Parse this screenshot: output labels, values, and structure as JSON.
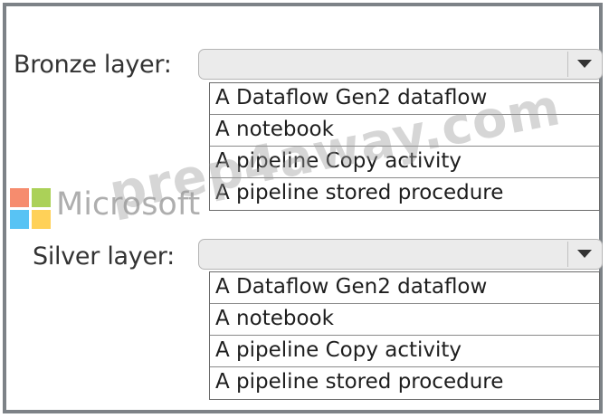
{
  "bronze": {
    "label": "Bronze layer:",
    "options": [
      "A Dataflow Gen2 dataflow",
      "A notebook",
      "A pipeline Copy activity",
      "A pipeline stored procedure"
    ]
  },
  "silver": {
    "label": "Silver layer:",
    "options": [
      "A Dataflow Gen2 dataflow",
      "A notebook",
      "A pipeline Copy activity",
      "A pipeline stored procedure"
    ]
  },
  "watermark": {
    "brand": "Microsoft",
    "site": "prep4away.com",
    "logo_colors": [
      "#f25022",
      "#7fba00",
      "#00a4ef",
      "#ffb900"
    ]
  },
  "icons": {
    "dropdown": "caret-down-icon"
  }
}
